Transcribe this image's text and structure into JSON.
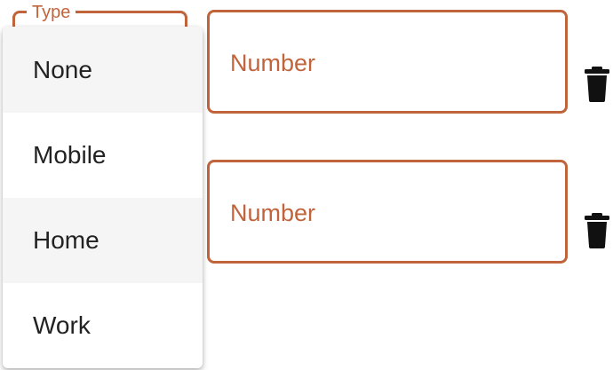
{
  "type_select": {
    "label": "Type",
    "options": [
      "None",
      "Mobile",
      "Home",
      "Work"
    ]
  },
  "phone_rows": [
    {
      "number_placeholder": "Number",
      "delete_icon": "trash-icon"
    },
    {
      "number_placeholder": "Number",
      "delete_icon": "trash-icon"
    }
  ],
  "colors": {
    "accent": "#c0643c",
    "menu_text": "#222222",
    "menu_highlight": "#f5f5f5",
    "icon": "#111111"
  }
}
